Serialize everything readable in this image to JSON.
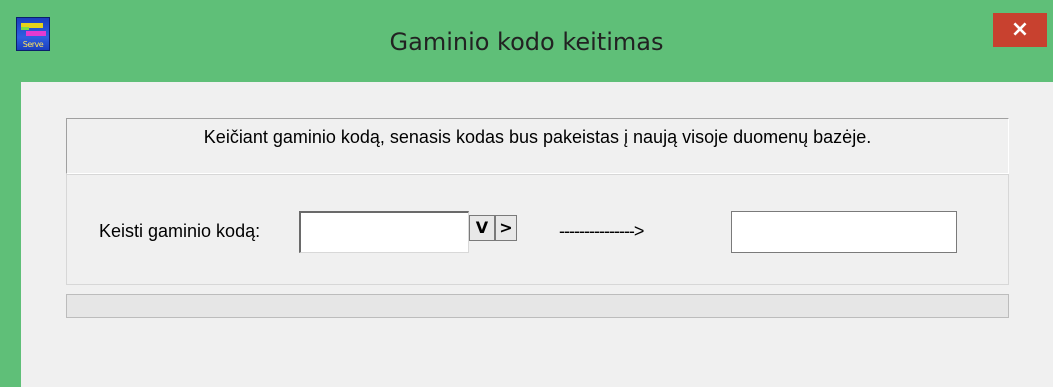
{
  "window": {
    "title": "Gaminio kodo keitimas",
    "icon": "serve-app-icon",
    "icon_text": "Serve",
    "close_label": "×"
  },
  "info": {
    "message": "Keičiant gaminio kodą, senasis kodas bus pakeistas į naują visoje duomenų bazėje."
  },
  "form": {
    "label": "Keisti gaminio kodą:",
    "old_code_value": "",
    "dropdown_icon": "▾",
    "dropdown_glyph": "V",
    "next_glyph": ">",
    "arrow_text": "--------------->",
    "new_code_value": ""
  },
  "progress": {
    "value": 0
  },
  "colors": {
    "titlebar": "#5fbf78",
    "close_button": "#c8412f",
    "dialog_background": "#f0f0f0"
  }
}
